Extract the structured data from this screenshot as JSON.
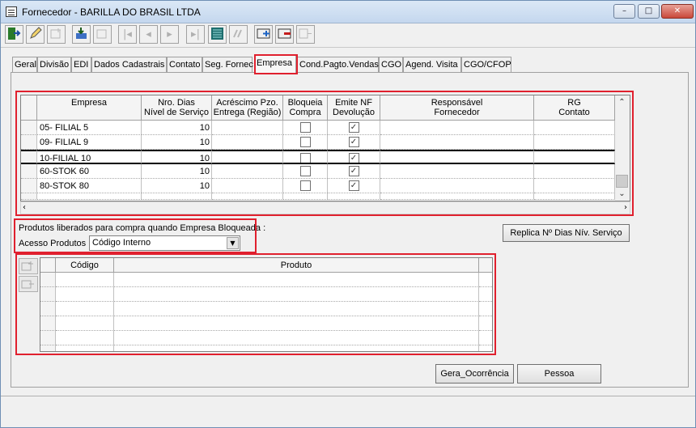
{
  "window": {
    "title": "Fornecedor - BARILLA DO BRASIL LTDA",
    "min": "–",
    "max": "□",
    "close": "✕"
  },
  "toolbar": {
    "icons": [
      "exit-icon",
      "edit-icon",
      "add-icon",
      "save-icon",
      "cancel-icon",
      "first-icon",
      "prev-icon",
      "next-icon",
      "last-icon",
      "list-icon",
      "filter-icon",
      "add-line-icon",
      "delete-line-icon",
      "copy-line-icon"
    ]
  },
  "tabs": [
    "Geral",
    "Divisão",
    "EDI",
    "Dados Cadastrais",
    "Contato",
    "Seg. Fornec",
    "Empresa",
    "Cond.Pagto.Vendas",
    "CGO",
    "Agend. Visita",
    "CGO/CFOP"
  ],
  "selected_tab": "Empresa",
  "empresa_grid": {
    "headers": {
      "empresa": "Empresa",
      "nro_dias": "Nro. Dias\nNível de Serviço",
      "acrescimo": "Acréscimo Pzo.\nEntrega (Região)",
      "bloqueia": "Bloqueia\nCompra",
      "emite_nf": "Emite NF\nDevolução",
      "responsavel": "Responsável\nFornecedor",
      "rg": "RG\nContato"
    },
    "rows": [
      {
        "empresa": "05- FILIAL 5",
        "dias": "10",
        "bloqueia": false,
        "emite": true
      },
      {
        "empresa": "09- FILIAL 9",
        "dias": "10",
        "bloqueia": false,
        "emite": true
      },
      {
        "empresa": "10-FILIAL 10",
        "dias": "10",
        "bloqueia": false,
        "emite": true
      },
      {
        "empresa": "60-STOK 60",
        "dias": "10",
        "bloqueia": false,
        "emite": true
      },
      {
        "empresa": "80-STOK 80",
        "dias": "10",
        "bloqueia": false,
        "emite": true
      }
    ]
  },
  "produtos": {
    "label": "Produtos liberados para compra quando Empresa Bloqueada :",
    "acesso_label": "Acesso Produtos",
    "acesso_value": "Código Interno"
  },
  "replica_button": "Replica Nº Dias Nív. Serviço",
  "produto_grid": {
    "headers": {
      "codigo": "Código",
      "produto": "Produto"
    }
  },
  "buttons": {
    "gera": "Gera_Ocorrência",
    "pessoa": "Pessoa"
  }
}
